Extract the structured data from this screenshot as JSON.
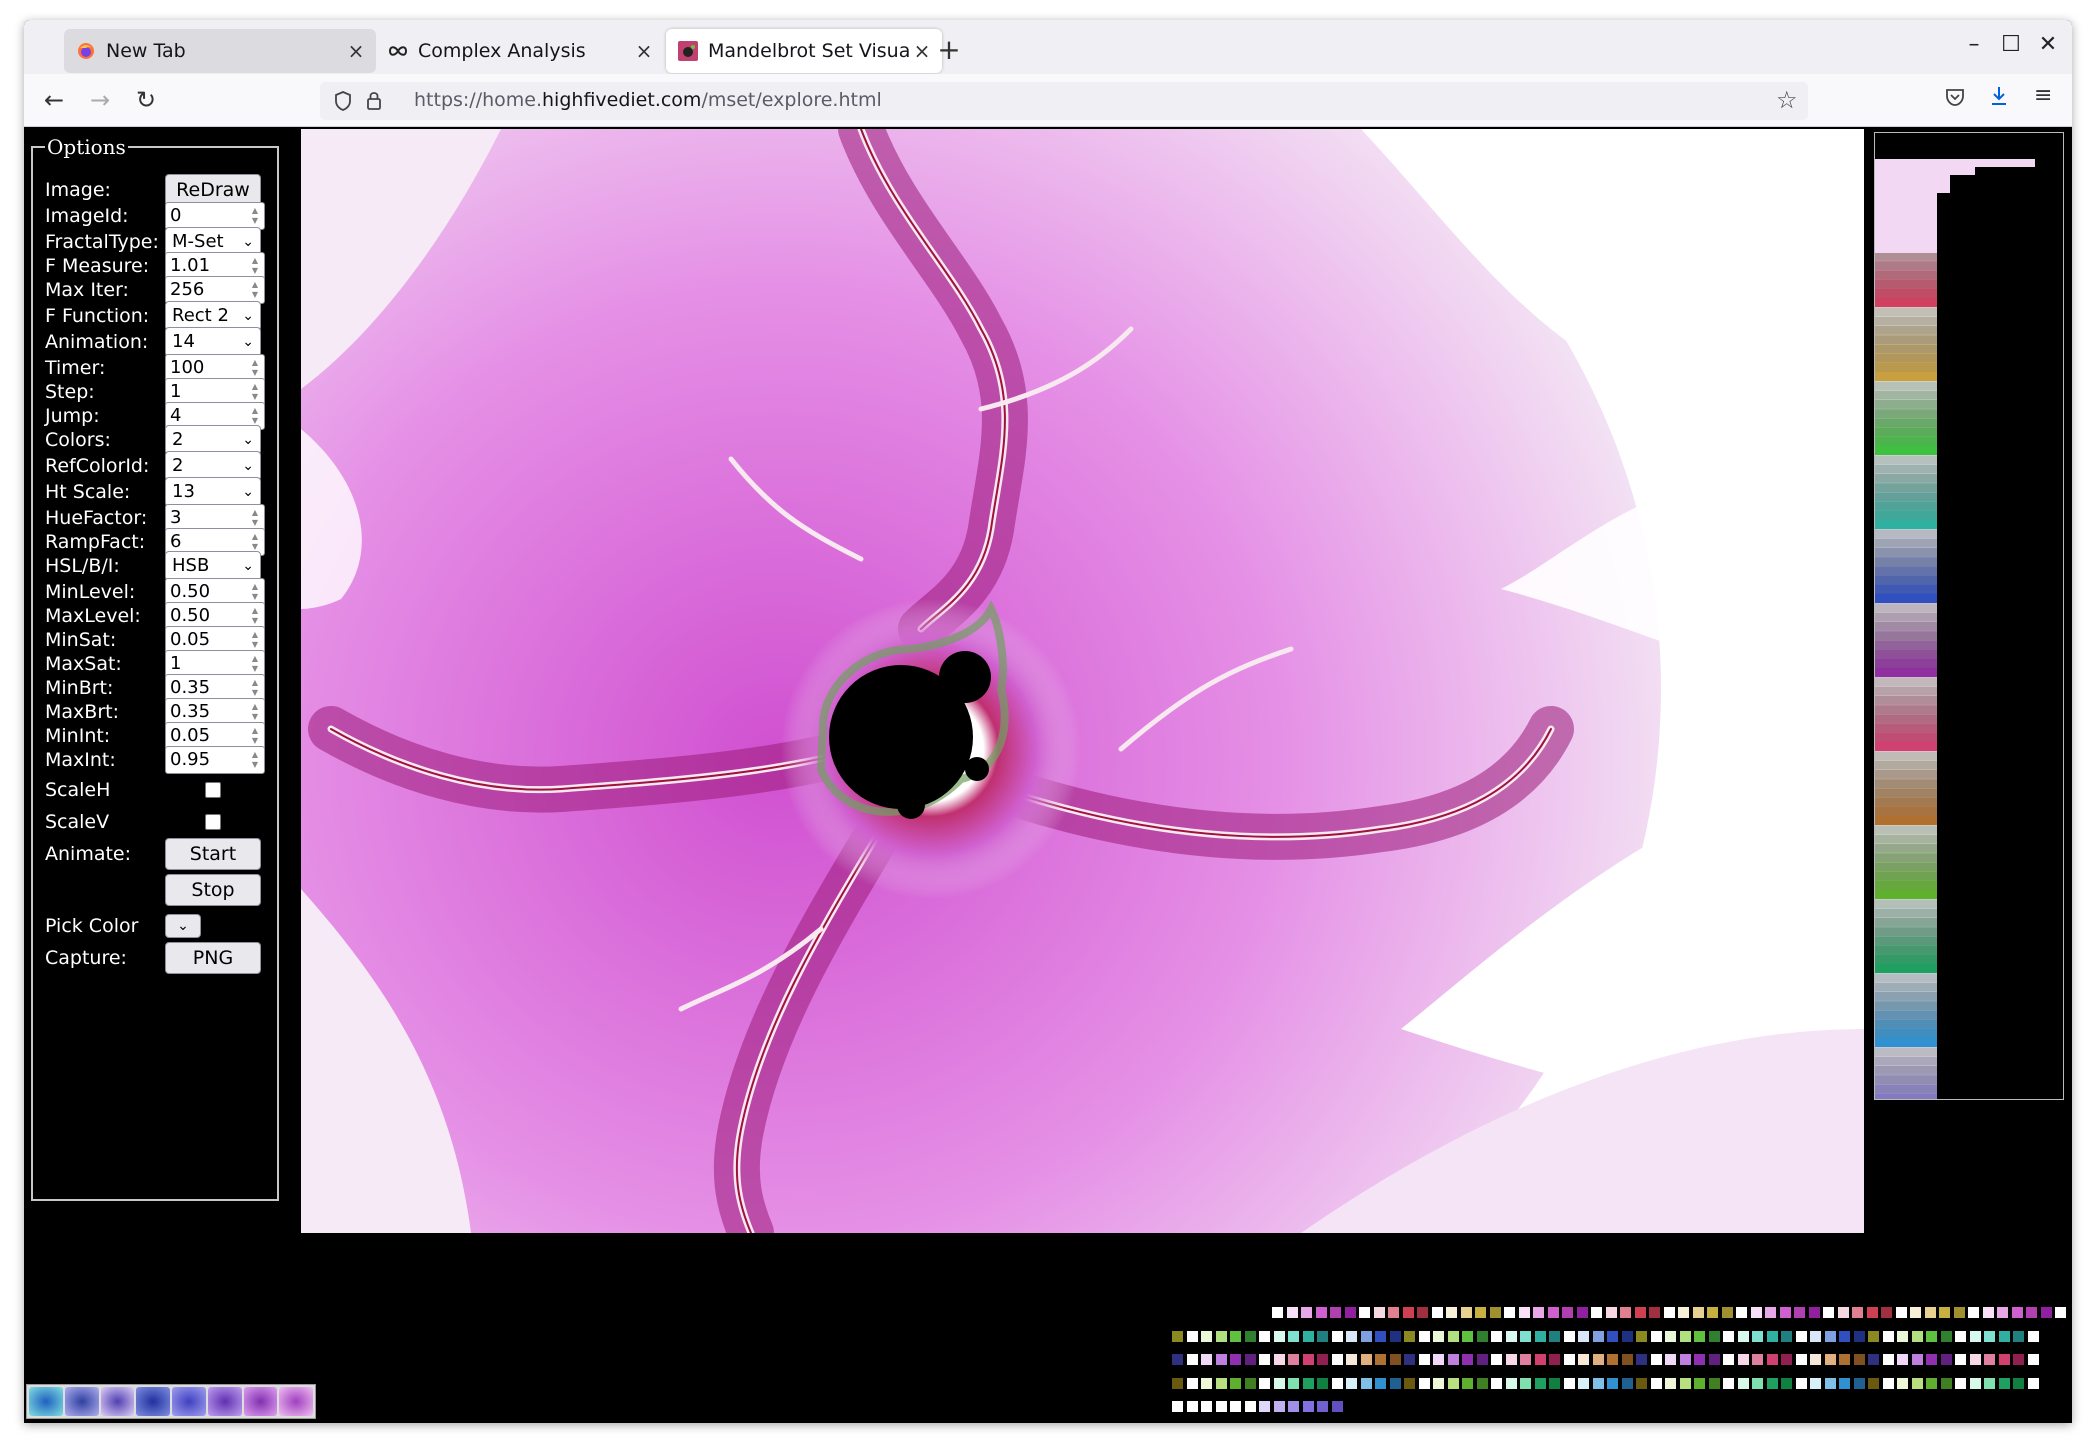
{
  "browser": {
    "tabs": [
      {
        "label": "New Tab",
        "icon": "firefox-icon"
      },
      {
        "label": "Complex Analysis",
        "icon": "infinity-icon"
      },
      {
        "label": "Mandelbrot Set Visualiza",
        "icon": "mandelbrot-icon"
      }
    ],
    "new_tab_symbol": "+",
    "url_scheme_prefix": "https://home.",
    "url_host": "highfivediet.com",
    "url_path": "/mset/explore.html"
  },
  "options": {
    "legend": "Options",
    "image_label": "Image:",
    "redraw_label": "ReDraw",
    "fields": [
      {
        "label": "ImageId:",
        "kind": "number",
        "value": "0"
      },
      {
        "label": "FractalType:",
        "kind": "select",
        "value": "M-Set"
      },
      {
        "label": "F Measure:",
        "kind": "number",
        "value": "1.01"
      },
      {
        "label": "Max Iter:",
        "kind": "number",
        "value": "256"
      },
      {
        "label": "F Function:",
        "kind": "select",
        "value": "Rect 2"
      },
      {
        "label": "Animation:",
        "kind": "select",
        "value": "14"
      },
      {
        "label": "Timer:",
        "kind": "number",
        "value": "100"
      },
      {
        "label": "Step:",
        "kind": "number",
        "value": "1"
      },
      {
        "label": "Jump:",
        "kind": "number",
        "value": "4"
      },
      {
        "label": "Colors:",
        "kind": "select",
        "value": "2"
      },
      {
        "label": "RefColorId:",
        "kind": "select",
        "value": "2"
      },
      {
        "label": "Ht Scale:",
        "kind": "select",
        "value": "13"
      },
      {
        "label": "HueFactor:",
        "kind": "number",
        "value": "3"
      },
      {
        "label": "RampFact:",
        "kind": "number",
        "value": "6"
      },
      {
        "label": "HSL/B/I:",
        "kind": "select",
        "value": "HSB"
      },
      {
        "label": "MinLevel:",
        "kind": "number",
        "value": "0.50"
      },
      {
        "label": "MaxLevel:",
        "kind": "number",
        "value": "0.50"
      },
      {
        "label": "MinSat:",
        "kind": "number",
        "value": "0.05"
      },
      {
        "label": "MaxSat:",
        "kind": "number",
        "value": "1"
      },
      {
        "label": "MinBrt:",
        "kind": "number",
        "value": "0.35"
      },
      {
        "label": "MaxBrt:",
        "kind": "number",
        "value": "0.35"
      },
      {
        "label": "MinInt:",
        "kind": "number",
        "value": "0.05"
      },
      {
        "label": "MaxInt:",
        "kind": "number",
        "value": "0.95"
      }
    ],
    "scaleh_label": "ScaleH",
    "scalev_label": "ScaleV",
    "animate_label": "Animate:",
    "start_label": "Start",
    "stop_label": "Stop",
    "pick_color_label": "Pick Color",
    "capture_label": "Capture:",
    "png_label": "PNG"
  },
  "colors": {
    "fractal_pink": "#e070e0",
    "fractal_magenta": "#b0208c",
    "fractal_light": "#eac6ec",
    "ramp_groups": [
      "#e0a0e0",
      "#d04060",
      "#c8a040",
      "#40c040",
      "#30b0a0",
      "#3050c0",
      "#9030a0",
      "#d04070",
      "#b07030",
      "#60b030",
      "#20a060",
      "#3090d0",
      "#8070e0"
    ]
  }
}
